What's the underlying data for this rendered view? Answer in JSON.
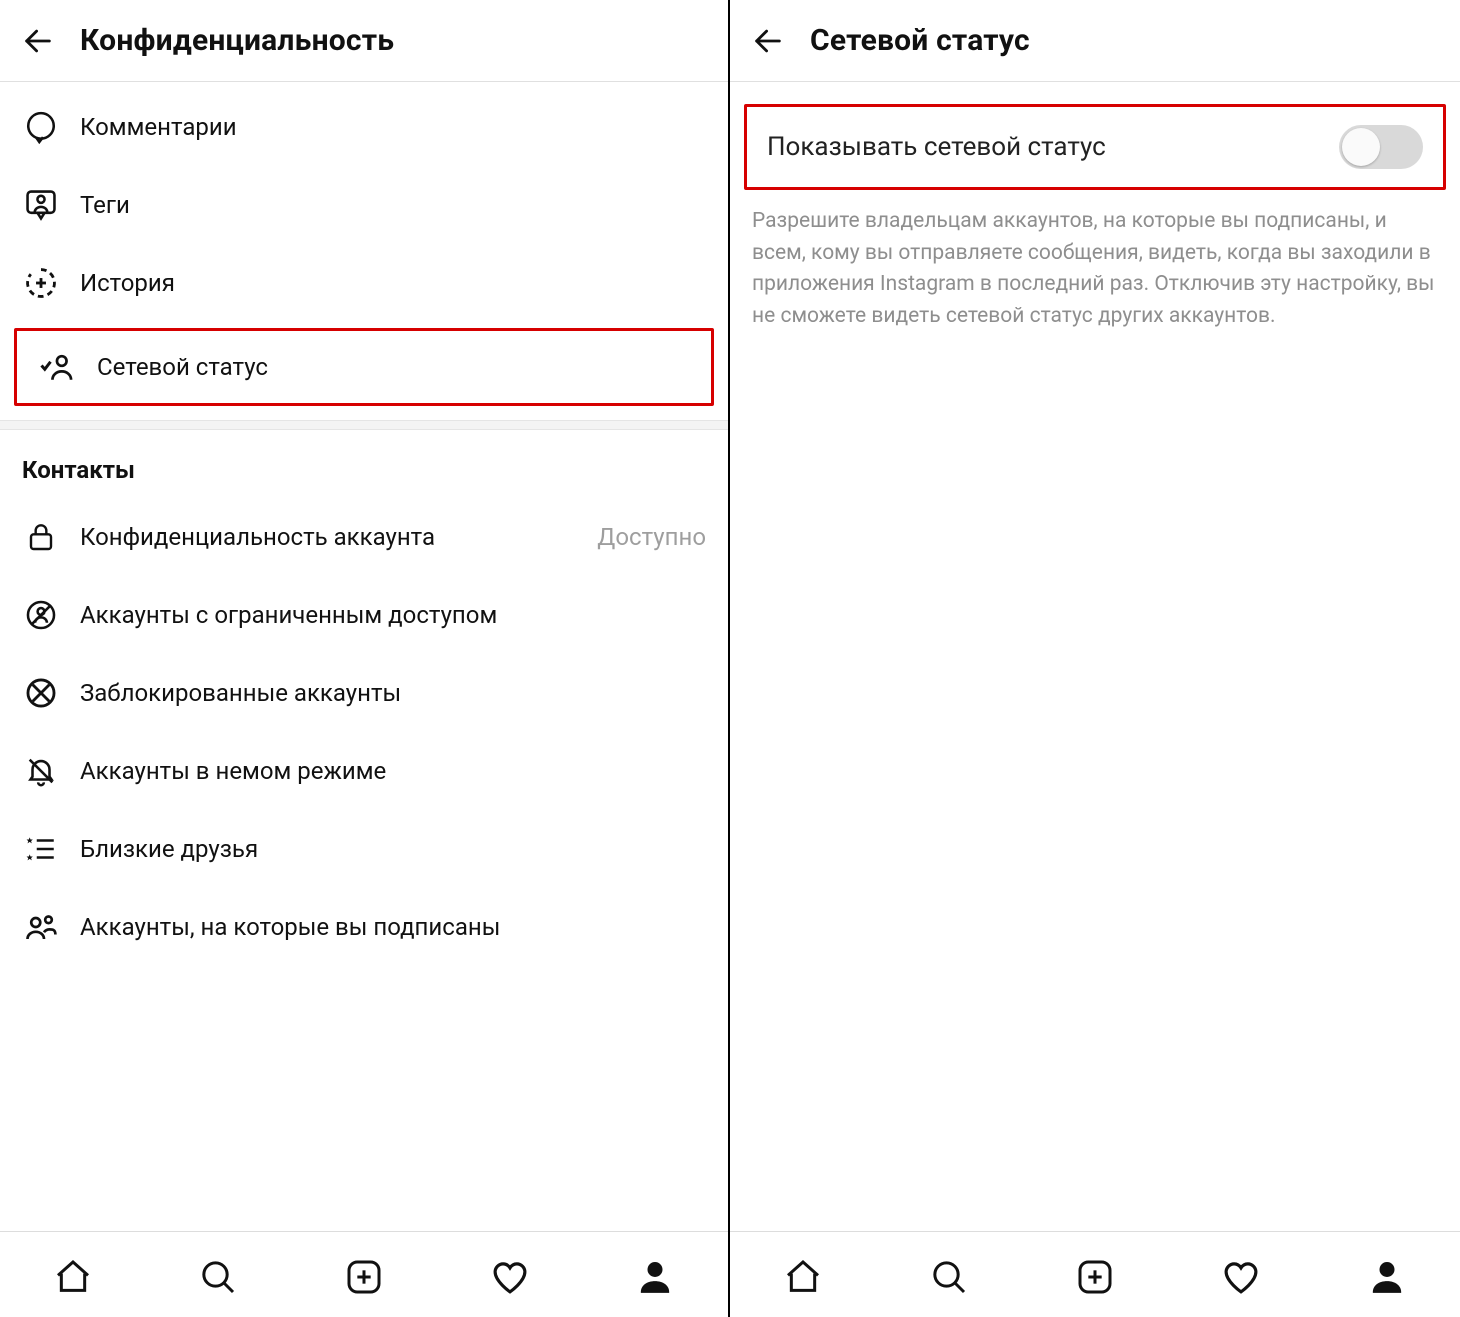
{
  "left": {
    "header_title": "Конфиденциальность",
    "interactions": [
      {
        "id": "comments",
        "label": "Комментарии"
      },
      {
        "id": "tags",
        "label": "Теги"
      },
      {
        "id": "story",
        "label": "История"
      },
      {
        "id": "activity",
        "label": "Сетевой статус",
        "highlighted": true
      }
    ],
    "contacts_header": "Контакты",
    "contacts": [
      {
        "id": "privacy",
        "label": "Конфиденциальность аккаунта",
        "trailing": "Доступно"
      },
      {
        "id": "restricted",
        "label": "Аккаунты с ограниченным доступом"
      },
      {
        "id": "blocked",
        "label": "Заблокированные аккаунты"
      },
      {
        "id": "muted",
        "label": "Аккаунты в немом режиме"
      },
      {
        "id": "close",
        "label": "Близкие друзья"
      },
      {
        "id": "following",
        "label": "Аккаунты, на которые вы подписаны"
      }
    ]
  },
  "right": {
    "header_title": "Сетевой статус",
    "toggle_label": "Показывать сетевой статус",
    "toggle_on": false,
    "description": "Разрешите владельцам аккаунтов, на которые вы подписаны, и всем, кому вы отправляете сообщения, видеть, когда вы заходили в приложения Instagram в последний раз. Отключив эту настройку, вы не сможете видеть сетевой статус других аккаунтов."
  },
  "nav_active": "profile"
}
